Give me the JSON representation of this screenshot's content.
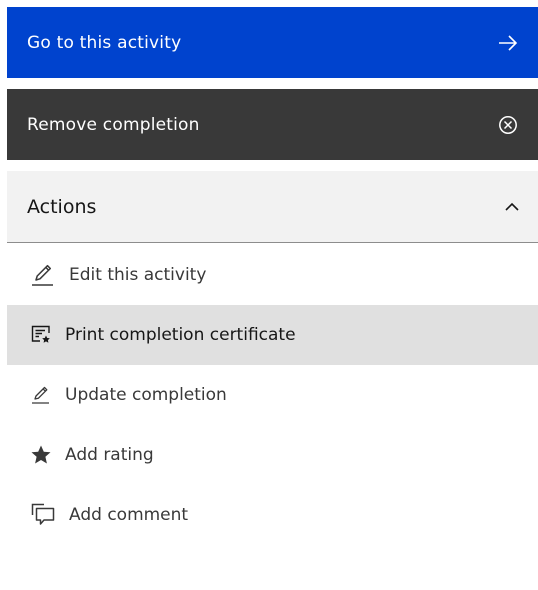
{
  "primary_button": {
    "label": "Go to this activity",
    "icon": "arrow-right-icon"
  },
  "secondary_button": {
    "label": "Remove completion",
    "icon": "close-outline-icon"
  },
  "actions": {
    "title": "Actions",
    "expanded": true,
    "icon": "chevron-up-icon",
    "items": [
      {
        "label": "Edit this activity",
        "icon": "edit-icon"
      },
      {
        "label": "Print completion certificate",
        "icon": "certificate-icon",
        "hovered": true
      },
      {
        "label": "Update completion",
        "icon": "edit-icon"
      },
      {
        "label": "Add rating",
        "icon": "star-icon"
      },
      {
        "label": "Add comment",
        "icon": "comment-icon"
      }
    ]
  },
  "colors": {
    "primary": "#0043ce",
    "secondary": "#393939",
    "accordion_bg": "#f2f2f2",
    "hover_bg": "#e0e0e0"
  }
}
